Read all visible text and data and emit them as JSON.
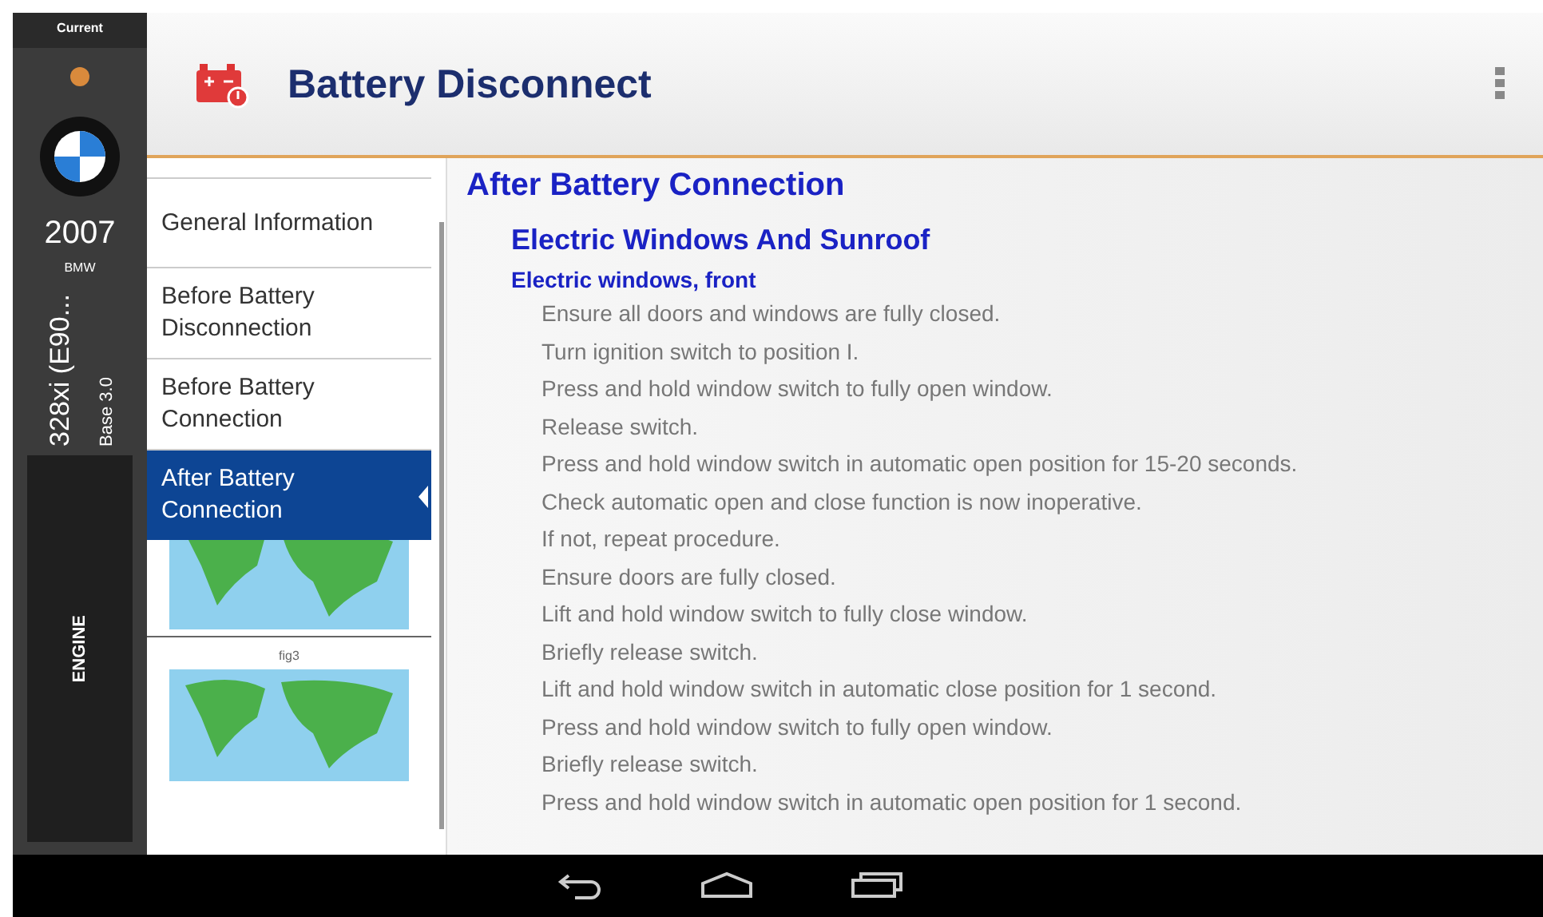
{
  "sidebar": {
    "label": "Current",
    "year": "2007",
    "make": "BMW",
    "model": "328xi (E90...",
    "engine": "Base 3.0",
    "button": "ENGINE"
  },
  "header": {
    "title": "Battery Disconnect"
  },
  "sections": [
    {
      "label": "General Information",
      "selected": false
    },
    {
      "label": "Before Battery Disconnection",
      "selected": false
    },
    {
      "label": "Before Battery Connection",
      "selected": false
    },
    {
      "label": "After Battery Connection",
      "selected": true
    }
  ],
  "figures": [
    {
      "kind": "cropped"
    },
    {
      "kind": "full",
      "caption": "fig3"
    }
  ],
  "content": {
    "title": "After Battery Connection",
    "subtitle": "Electric Windows And Sunroof",
    "heading": "Electric windows, front",
    "steps": [
      "Ensure all doors and windows are fully closed.",
      "Turn ignition switch to position I.",
      "Press and hold window switch to fully open window.",
      "Release switch.",
      "Press and hold window switch in automatic open position for 15-20 seconds.",
      "Check automatic open and close function is now inoperative.",
      "If not, repeat procedure.",
      "Ensure doors are fully closed.",
      "Lift and hold window switch to fully close window.",
      "Briefly release switch.",
      "Lift and hold window switch in automatic close position for 1 second.",
      "Press and hold window switch to fully open window.",
      "Briefly release switch.",
      "Press and hold window switch in automatic open position for 1 second."
    ]
  }
}
